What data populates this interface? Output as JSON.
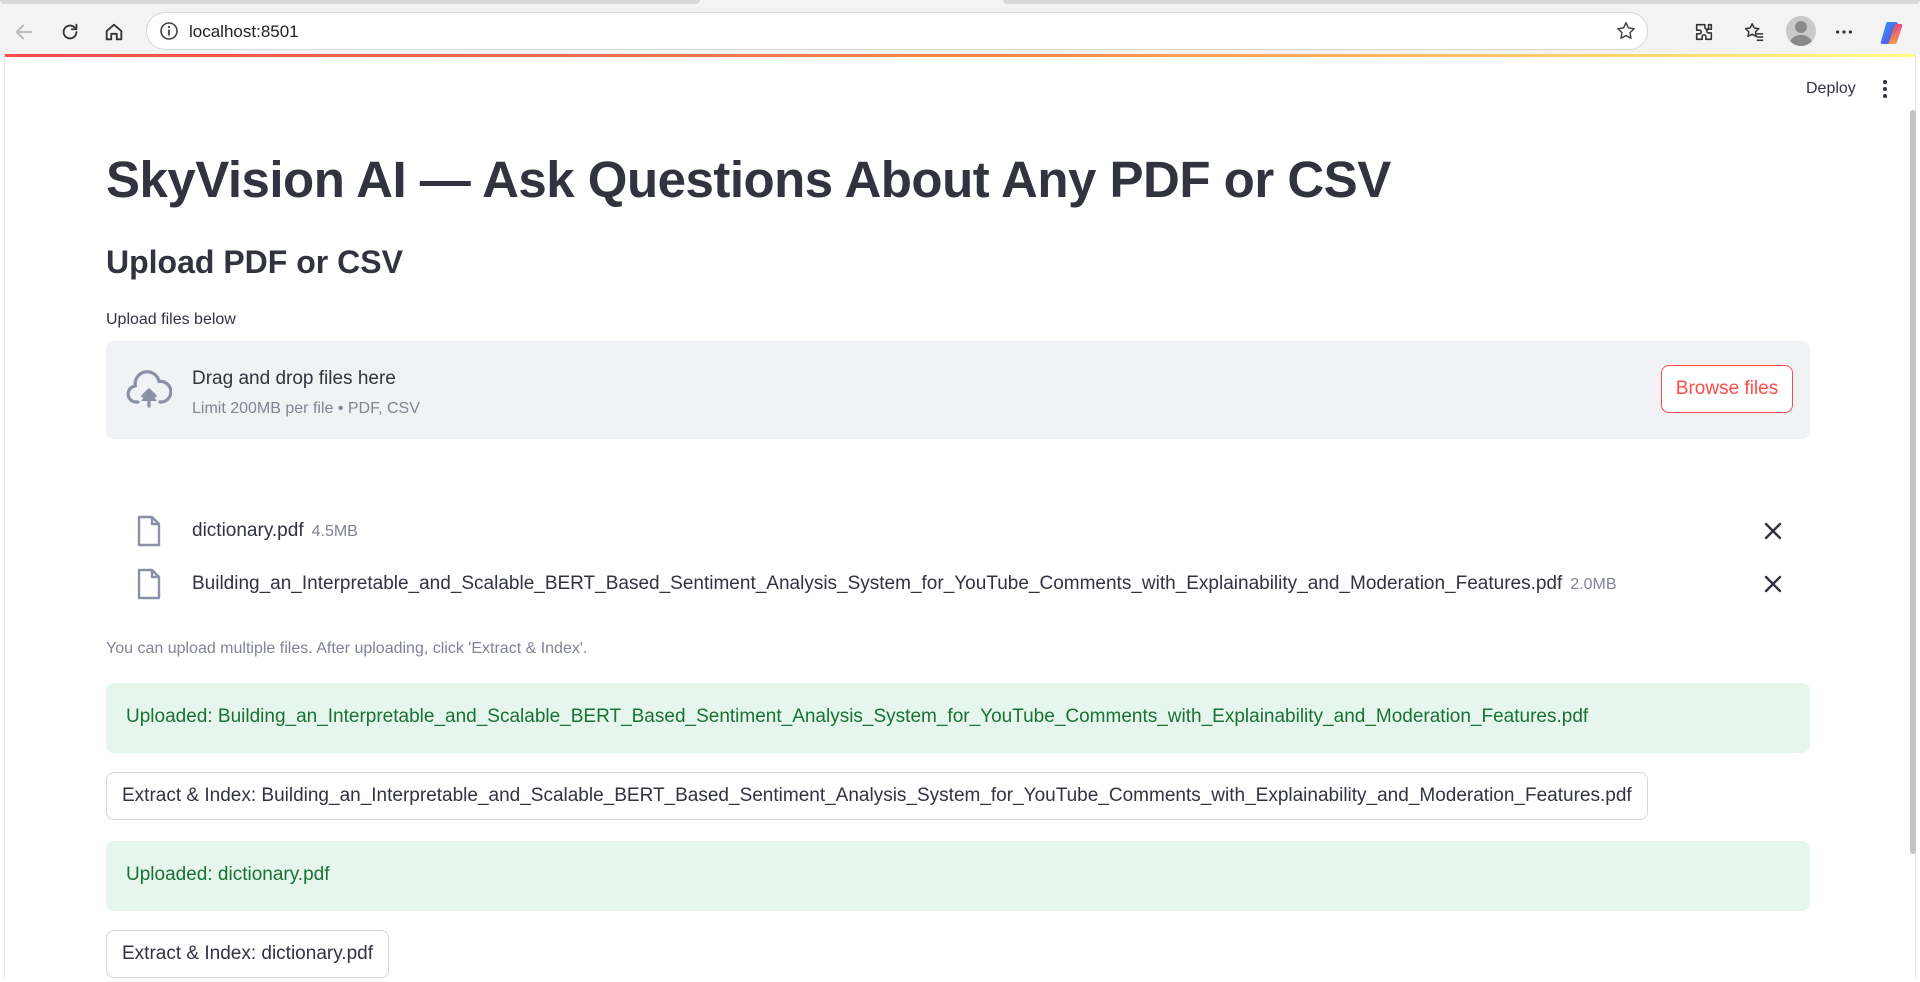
{
  "browser": {
    "url": "localhost:8501"
  },
  "header": {
    "deploy_label": "Deploy"
  },
  "main": {
    "title": "SkyVision AI — Ask Questions About Any PDF or CSV",
    "subheader": "Upload PDF or CSV",
    "uploader": {
      "label": "Upload files below",
      "drop_title": "Drag and drop files here",
      "drop_sub": "Limit 200MB per file • PDF, CSV",
      "browse_label": "Browse files"
    },
    "files": [
      {
        "name": "dictionary.pdf",
        "size": "4.5MB"
      },
      {
        "name": "Building_an_Interpretable_and_Scalable_BERT_Based_Sentiment_Analysis_System_for_YouTube_Comments_with_Explainability_and_Moderation_Features.pdf",
        "size": "2.0MB"
      }
    ],
    "caption": "You can upload multiple files. After uploading, click 'Extract & Index'.",
    "results": [
      {
        "success": "Uploaded: Building_an_Interpretable_and_Scalable_BERT_Based_Sentiment_Analysis_System_for_YouTube_Comments_with_Explainability_and_Moderation_Features.pdf",
        "button": "Extract & Index: Building_an_Interpretable_and_Scalable_BERT_Based_Sentiment_Analysis_System_for_YouTube_Comments_with_Explainability_and_Moderation_Features.pdf"
      },
      {
        "success": "Uploaded: dictionary.pdf",
        "button": "Extract & Index: dictionary.pdf"
      }
    ]
  },
  "theme": {
    "primary": "#ff4b4b",
    "success_bg": "#e7f6ec",
    "success_text": "#177233",
    "text": "#31333f",
    "muted": "#808495"
  },
  "icons": {
    "back": "arrow-left-icon",
    "reload": "reload-icon",
    "home": "home-icon",
    "info": "info-icon",
    "favorite": "star-icon",
    "extensions": "puzzle-icon",
    "favorites": "favorites-icon",
    "profile": "avatar",
    "more": "more-icon",
    "copilot": "copilot-icon",
    "upload": "cloud-upload-icon",
    "file": "file-icon",
    "remove": "close-icon"
  }
}
